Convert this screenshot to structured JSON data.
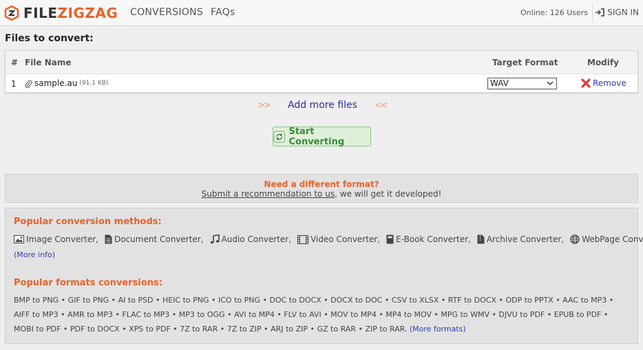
{
  "header": {
    "logo_part1": "FILE",
    "logo_part2": "ZIGZAG",
    "nav": [
      "CONVERSIONS",
      "FAQs"
    ],
    "online": "Online: 126 Users",
    "signin": "SIGN IN"
  },
  "files": {
    "title": "Files to convert:",
    "columns": {
      "num": "#",
      "name": "File Name",
      "target": "Target Format",
      "modify": "Modify"
    },
    "rows": [
      {
        "num": "1",
        "name": "sample.au",
        "size": "(91.1 KB)",
        "format": "WAV",
        "action": "Remove"
      }
    ],
    "add_more": "Add more files",
    "add_more_left_icon": ">>",
    "add_more_right_icon": "<<",
    "start": "Start Converting"
  },
  "need": {
    "title": "Need a different format?",
    "link": "Submit a recommendation to us",
    "rest": ", we will get it developed!"
  },
  "popular": {
    "methods_title": "Popular conversion methods:",
    "methods": [
      {
        "icon": "image-icon",
        "label": "Image Converter,"
      },
      {
        "icon": "document-icon",
        "label": "Document Converter,"
      },
      {
        "icon": "music-icon",
        "label": "Audio Converter,"
      },
      {
        "icon": "film-icon",
        "label": "Video Converter,"
      },
      {
        "icon": "book-icon",
        "label": "E-Book Converter,"
      },
      {
        "icon": "archive-icon",
        "label": "Archive Converter,"
      },
      {
        "icon": "globe-icon",
        "label": "WebPage Converter."
      }
    ],
    "more_info": "(More info)",
    "formats_title": "Popular formats conversions:",
    "formats_lines": [
      "BMP to PNG • GIF to PNG • AI to PSD • HEIC to PNG • ICO to PNG • DOC to DOCX • DOCX to DOC • CSV to XLSX • RTF to DOCX • ODP to PPTX • AAC to MP3 •",
      "AIFF to MP3 • AMR to MP3 • FLAC to MP3 • MP3 to OGG • AVI to MP4 • FLV to AVI • MOV to MP4 • MP4 to MOV • MPG to WMV • DJVU to PDF • EPUB to PDF •",
      "MOBI to PDF • PDF to DOCX • XPS to PDF • 7Z to RAR • 7Z to ZIP • ARJ to ZIP • GZ to RAR • ZIP to RAR."
    ],
    "more_formats": "(More formats)"
  }
}
